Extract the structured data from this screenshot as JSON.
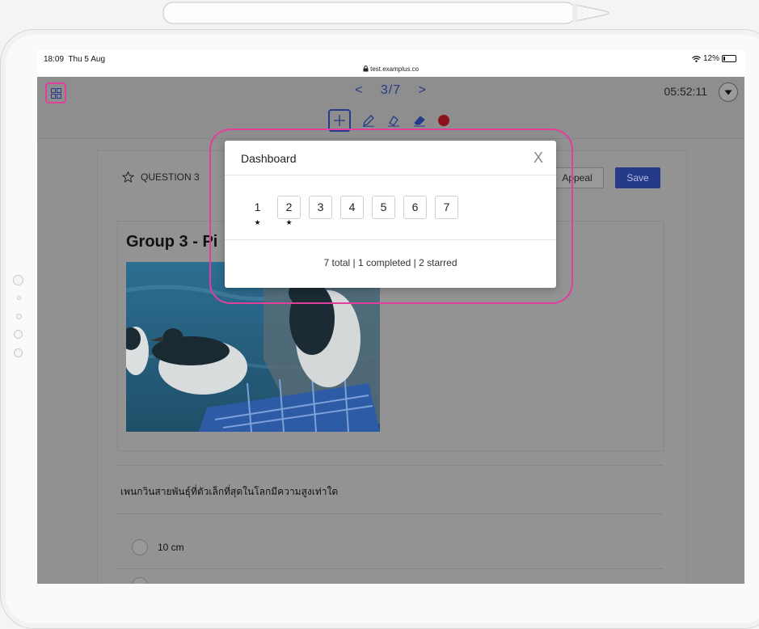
{
  "status": {
    "time": "18:09",
    "date": "Thu 5 Aug",
    "url": "test.examplus.co",
    "battery": "12%"
  },
  "topbar": {
    "nav_prev": "<",
    "page_indicator": "3/7",
    "nav_next": ">",
    "timer": "05:52:11"
  },
  "question": {
    "header": "QUESTION 3",
    "appeal_label": "Appeal",
    "save_label": "Save"
  },
  "content": {
    "group_title": "Group 3 - Pi",
    "prompt": "เพนกวินสายพันธุ์ที่ตัวเล็กที่สุดในโลกมีความสูงเท่าใด",
    "options": [
      "10 cm"
    ]
  },
  "dashboard": {
    "title": "Dashboard",
    "close": "X",
    "questions": [
      {
        "label": "1",
        "starred": true,
        "current": true
      },
      {
        "label": "2",
        "starred": true,
        "current": false
      },
      {
        "label": "3",
        "starred": false,
        "current": false
      },
      {
        "label": "4",
        "starred": false,
        "current": false
      },
      {
        "label": "5",
        "starred": false,
        "current": false
      },
      {
        "label": "6",
        "starred": false,
        "current": false
      },
      {
        "label": "7",
        "starred": false,
        "current": false
      }
    ],
    "summary": "7 total | 1 completed | 2 starred"
  },
  "colors": {
    "highlight": "#e0409b",
    "primary": "#263a8a",
    "record": "#d6242c"
  },
  "icons": [
    "grid-icon",
    "move-icon",
    "pencil-icon",
    "highlighter-icon",
    "eraser-icon",
    "record-dot-icon",
    "star-outline-icon",
    "chevron-down-icon",
    "wifi-icon",
    "lock-icon"
  ]
}
